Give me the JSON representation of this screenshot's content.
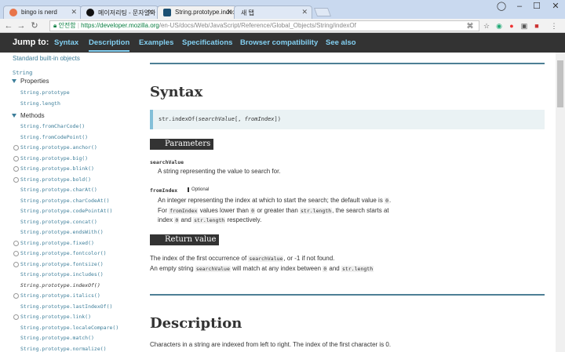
{
  "browser": {
    "tabs": [
      {
        "title": "bingo is nerd",
        "favicon_color": "#e8744a"
      },
      {
        "title": "메이저리팅 - 문자열과 ...",
        "favicon_color": "#111111"
      },
      {
        "title": "String.prototype.indexOf...",
        "favicon_color": "#1b4f72"
      },
      {
        "title": "새 탭",
        "favicon_color": "#ffffff"
      }
    ],
    "secure_label": "안전함",
    "url_host": "https://developer.mozilla.org",
    "url_path": "/en-US/docs/Web/JavaScript/Reference/Global_Objects/String/indexOf"
  },
  "jumpbar": {
    "label": "Jump to:",
    "links": [
      "Syntax",
      "Description",
      "Examples",
      "Specifications",
      "Browser compatibility",
      "See also"
    ]
  },
  "sidebar": {
    "heading": "Standard built-in objects",
    "object": "String",
    "properties_label": "Properties",
    "properties": [
      "String.prototype",
      "String.length"
    ],
    "methods_label": "Methods",
    "methods": [
      "String.fromCharCode()",
      "String.fromCodePoint()",
      "String.prototype.anchor()",
      "String.prototype.big()",
      "String.prototype.blink()",
      "String.prototype.bold()",
      "String.prototype.charAt()",
      "String.prototype.charCodeAt()",
      "String.prototype.codePointAt()",
      "String.prototype.concat()",
      "String.prototype.endsWith()",
      "String.prototype.fixed()",
      "String.prototype.fontcolor()",
      "String.prototype.fontsize()",
      "String.prototype.includes()",
      "String.prototype.indexOf()",
      "String.prototype.italics()",
      "String.prototype.lastIndexOf()",
      "String.prototype.link()",
      "String.prototype.localeCompare()",
      "String.prototype.match()",
      "String.prototype.normalize()"
    ]
  },
  "main": {
    "syntax_heading": "Syntax",
    "syntax_code": "str.indexOf(searchValue[, fromIndex])",
    "parameters_heading": "Parameters",
    "param1_name": "searchValue",
    "param1_desc": "A string representing the value to search for.",
    "param2_name": "fromIndex",
    "param2_optional": "Optional",
    "param2_desc_1a": "An integer representing the index at which to start the search; the default value is ",
    "param2_desc_1code": "0",
    "param2_desc_1b": ".",
    "param2_desc_2a": "For ",
    "param2_desc_2code1": "fromIndex",
    "param2_desc_2b": " values lower than ",
    "param2_desc_2code2": "0",
    "param2_desc_2c": " or greater than ",
    "param2_desc_2code3": "str.length",
    "param2_desc_2d": ", the search starts at",
    "param2_desc_3a": "index ",
    "param2_desc_3code1": "0",
    "param2_desc_3b": " and ",
    "param2_desc_3code2": "str.length",
    "param2_desc_3c": " respectively.",
    "return_heading": "Return value",
    "return_1a": "The index of the first occurrence of ",
    "return_1code": "searchValue",
    "return_1b": ", or -1 if not found.",
    "return_2a": "An empty string ",
    "return_2code": "searchValue",
    "return_2b": " will match at any index between ",
    "return_2code2": "0",
    "return_2c": " and ",
    "return_2code3": "str.length",
    "description_heading": "Description",
    "description_text": "Characters in a string are indexed from left to right. The index of the first character is 0."
  }
}
